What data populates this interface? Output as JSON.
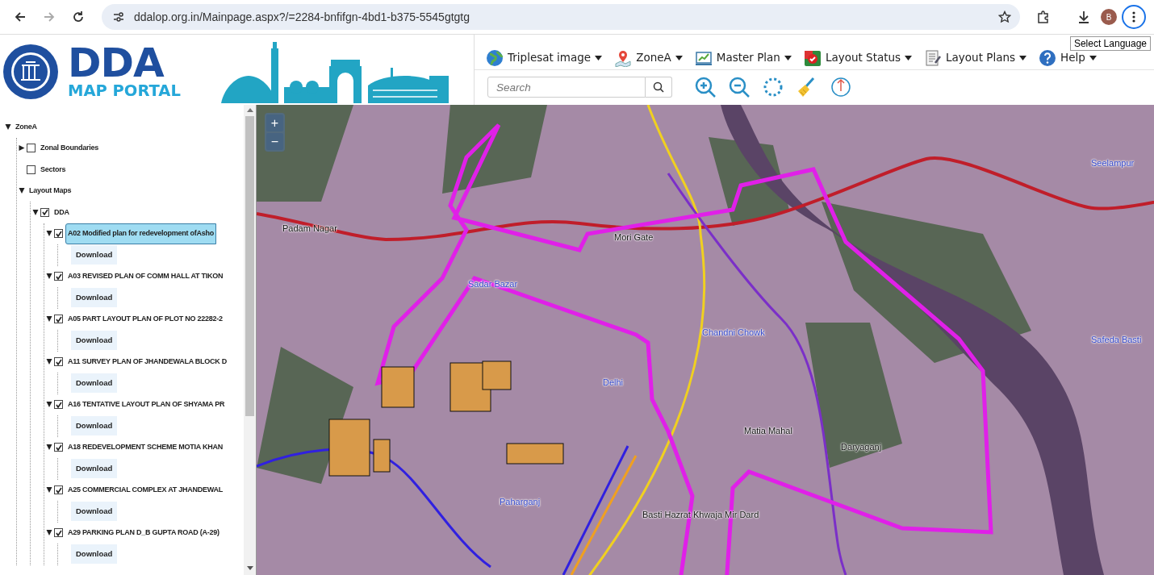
{
  "browser": {
    "url": "ddalop.org.in/Mainpage.aspx?/=2284-bnfifgn-4bd1-b375-5545gtgtg",
    "profile_initial": "B",
    "tooltip": "Select Language"
  },
  "logo": {
    "title": "DDA",
    "subtitle": "MAP PORTAL"
  },
  "menu": [
    {
      "label": "Triplesat image"
    },
    {
      "label": "ZoneA"
    },
    {
      "label": "Master Plan"
    },
    {
      "label": "Layout Status"
    },
    {
      "label": "Layout Plans"
    },
    {
      "label": "Help"
    }
  ],
  "search": {
    "placeholder": "Search"
  },
  "tree": [
    {
      "kind": "item",
      "label": "ZoneA",
      "expanded": true,
      "children": [
        {
          "kind": "item",
          "label": "Zonal Boundaries",
          "expanded": false,
          "checked": false,
          "selected": false
        },
        {
          "kind": "item",
          "label": "Sectors",
          "checked": false,
          "selected": false
        },
        {
          "kind": "item",
          "label": "Layout Maps",
          "expanded": true,
          "children": [
            {
              "kind": "item",
              "label": "DDA",
              "expanded": true,
              "checked": true,
              "selected": false,
              "children": [
                {
                  "kind": "item",
                  "label": "A02 Modified plan for redevelopment ofAsho",
                  "expanded": true,
                  "checked": true,
                  "selected": true,
                  "children": [
                    {
                      "kind": "download",
                      "label": "Download"
                    }
                  ]
                },
                {
                  "kind": "item",
                  "label": "A03 REVISED PLAN OF COMM HALL AT TIKON",
                  "expanded": true,
                  "checked": true,
                  "selected": false,
                  "children": [
                    {
                      "kind": "download",
                      "label": "Download"
                    }
                  ]
                },
                {
                  "kind": "item",
                  "label": "A05 PART LAYOUT PLAN OF PLOT NO 22282-2",
                  "expanded": true,
                  "checked": true,
                  "selected": false,
                  "children": [
                    {
                      "kind": "download",
                      "label": "Download"
                    }
                  ]
                },
                {
                  "kind": "item",
                  "label": "A11 SURVEY PLAN OF JHANDEWALA BLOCK D",
                  "expanded": true,
                  "checked": true,
                  "selected": false,
                  "children": [
                    {
                      "kind": "download",
                      "label": "Download"
                    }
                  ]
                },
                {
                  "kind": "item",
                  "label": "A16 TENTATIVE LAYOUT PLAN OF SHYAMA PR",
                  "expanded": true,
                  "checked": true,
                  "selected": false,
                  "children": [
                    {
                      "kind": "download",
                      "label": "Download"
                    }
                  ]
                },
                {
                  "kind": "item",
                  "label": "A18 REDEVELOPMENT SCHEME MOTIA KHAN",
                  "expanded": true,
                  "checked": true,
                  "selected": false,
                  "children": [
                    {
                      "kind": "download",
                      "label": "Download"
                    }
                  ]
                },
                {
                  "kind": "item",
                  "label": "A25 COMMERCIAL COMPLEX AT JHANDEWAL",
                  "expanded": true,
                  "checked": true,
                  "selected": false,
                  "children": [
                    {
                      "kind": "download",
                      "label": "Download"
                    }
                  ]
                },
                {
                  "kind": "item",
                  "label": "A29 PARKING PLAN D_B GUPTA ROAD (A-29)",
                  "expanded": true,
                  "checked": true,
                  "selected": false,
                  "children": [
                    {
                      "kind": "download",
                      "label": "Download"
                    }
                  ]
                }
              ]
            }
          ]
        }
      ]
    }
  ],
  "map": {
    "zoom_in": "+",
    "zoom_out": "−",
    "labels": [
      {
        "text": "Padam Nagar",
        "color": "#111111"
      },
      {
        "text": "Mori Gate",
        "color": "#111111"
      },
      {
        "text": "Sadar Bazar",
        "color": "#3346c8"
      },
      {
        "text": "Chandni Chowk",
        "color": "#3346c8"
      },
      {
        "text": "Delhi",
        "color": "#3346c8"
      },
      {
        "text": "Matia Mahal",
        "color": "#111111"
      },
      {
        "text": "Daryaganj",
        "color": "#111111"
      },
      {
        "text": "Paharganj",
        "color": "#3346c8"
      },
      {
        "text": "Basti Hazrat Khwaja Mir Dard",
        "color": "#111111"
      },
      {
        "text": "Seelampur",
        "color": "#3346c8"
      },
      {
        "text": "Safeda Basti",
        "color": "#3346c8"
      }
    ]
  }
}
